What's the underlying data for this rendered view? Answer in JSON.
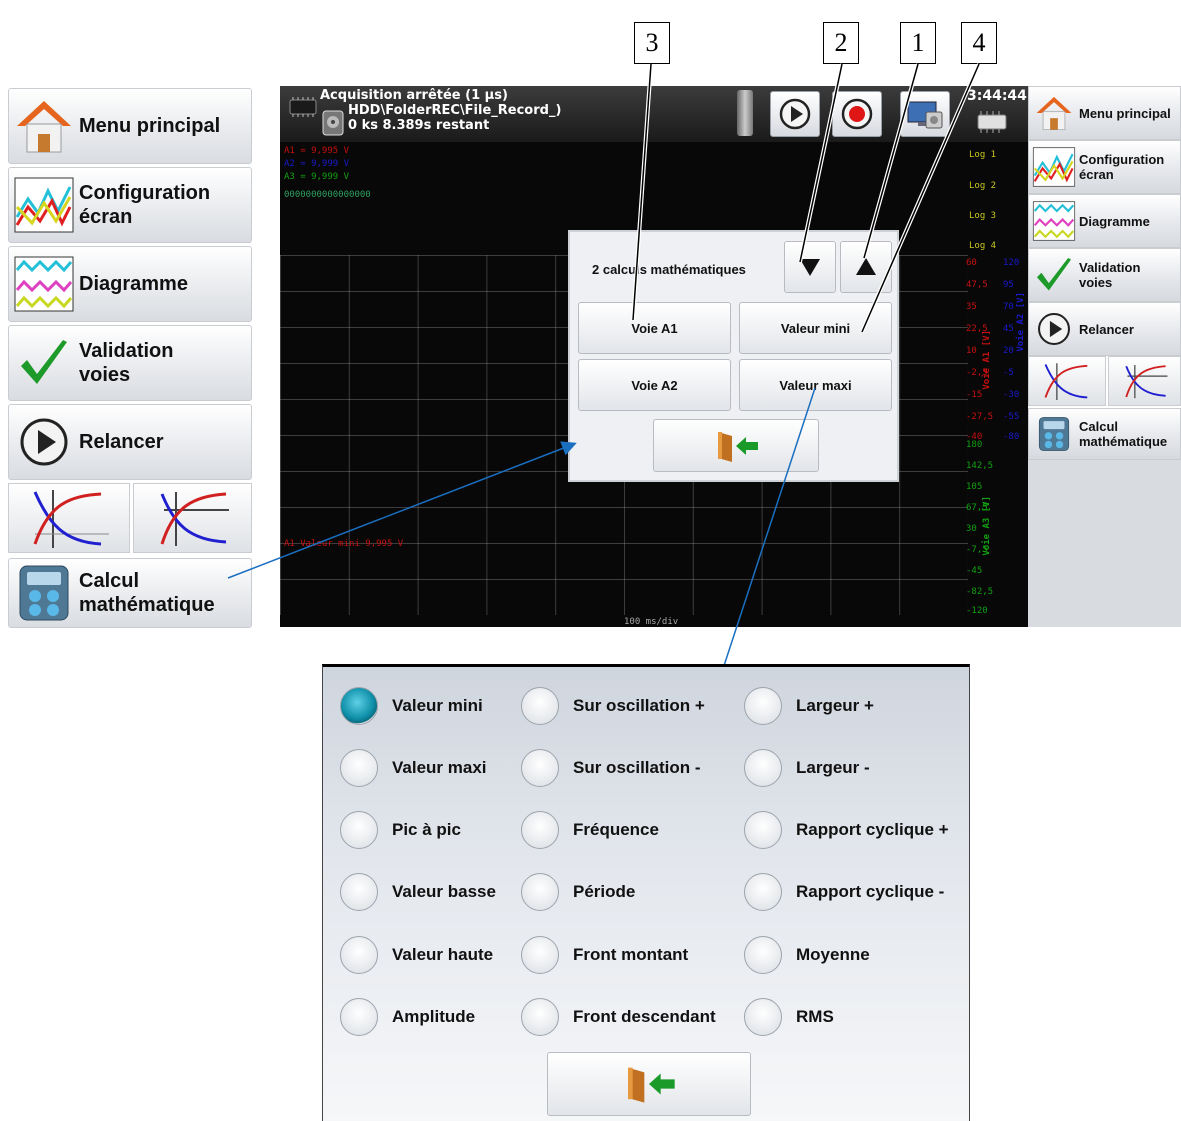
{
  "left_menu": {
    "items": [
      {
        "label": "Menu principal",
        "icon": "home-icon"
      },
      {
        "label": "Configuration\nécran",
        "icon": "screen-config-icon"
      },
      {
        "label": "Diagramme",
        "icon": "diagram-icon"
      },
      {
        "label": "Validation\nvoies",
        "icon": "checkmark-icon"
      },
      {
        "label": "Relancer",
        "icon": "play-icon"
      },
      {
        "label": "Calcul\nmathématique",
        "icon": "calculator-icon"
      }
    ]
  },
  "status": {
    "line1": "Acquisition arrêtée (1 µs)",
    "line2": "HDD\\FolderREC\\File_Record_)",
    "line3": "0 ks 8.389s restant",
    "time": "3:44:44"
  },
  "channels": {
    "a1": "A1 = 9,995 V",
    "a2": "A2 = 9,999 V",
    "a3": "A3 = 9,999 V",
    "logic": "0000000000000000"
  },
  "logs": [
    "Log 1",
    "Log 2",
    "Log 3",
    "Log 4"
  ],
  "scope_bottom": {
    "measure": "A1 Valeur mini 9,995 V",
    "timebase": "100 ms/div"
  },
  "axis_left": [
    "60",
    "47,5",
    "35",
    "22,5",
    "10",
    "-2,5",
    "-15",
    "-27,5",
    "-40"
  ],
  "axis_left_b": [
    "180",
    "142,5",
    "105",
    "67,5",
    "30",
    "-7,5",
    "-45",
    "-82,5",
    "-120"
  ],
  "axis_right": [
    "120",
    "95",
    "70",
    "45",
    "20",
    "-5",
    "-30",
    "-55",
    "-80"
  ],
  "axis_labels": {
    "a1": "Voie A1 [V]",
    "a3": "Voie A3 [V]",
    "a2": "Voie A2 [V]"
  },
  "dialog": {
    "title": "2 calculs mathématiques",
    "rows": [
      {
        "channel": "Voie A1",
        "calc": "Valeur mini"
      },
      {
        "channel": "Voie A2",
        "calc": "Valeur maxi"
      }
    ]
  },
  "callouts": [
    "3",
    "2",
    "1",
    "4"
  ],
  "right_menu": {
    "items": [
      {
        "label": "Menu principal"
      },
      {
        "label": "Configuration\nécran"
      },
      {
        "label": "Diagramme"
      },
      {
        "label": "Validation\nvoies"
      },
      {
        "label": "Relancer"
      },
      {
        "label": "Calcul\nmathématique"
      }
    ]
  },
  "options": {
    "col1": [
      "Valeur mini",
      "Valeur maxi",
      "Pic à pic",
      "Valeur basse",
      "Valeur haute",
      "Amplitude"
    ],
    "col2": [
      "Sur oscillation +",
      "Sur oscillation -",
      "Fréquence",
      "Période",
      "Front montant",
      "Front descendant"
    ],
    "col3": [
      "Largeur +",
      "Largeur -",
      "Rapport cyclique +",
      "Rapport cyclique -",
      "Moyenne",
      "RMS"
    ],
    "selected": "Valeur mini"
  },
  "colors": {
    "a1": "#c81010",
    "a2": "#1a1acc",
    "a3": "#12a012",
    "accent": "#0e8fa8"
  }
}
